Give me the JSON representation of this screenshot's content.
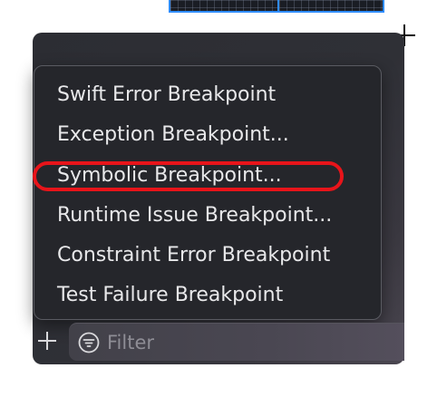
{
  "menu": {
    "items": [
      {
        "label": "Swift Error Breakpoint"
      },
      {
        "label": "Exception Breakpoint..."
      },
      {
        "label": "Symbolic Breakpoint..."
      },
      {
        "label": "Runtime Issue Breakpoint..."
      },
      {
        "label": "Constraint Error Breakpoint"
      },
      {
        "label": "Test Failure Breakpoint"
      }
    ],
    "highlighted_index": 2
  },
  "toolbar": {
    "add_icon": "plus-icon",
    "filter_icon": "filter-icon",
    "filter_placeholder": "Filter",
    "filter_value": ""
  },
  "colors": {
    "highlight_ring": "#e8141a",
    "panel_bg": "#2c2d33",
    "menu_text": "#e8e8ea"
  }
}
